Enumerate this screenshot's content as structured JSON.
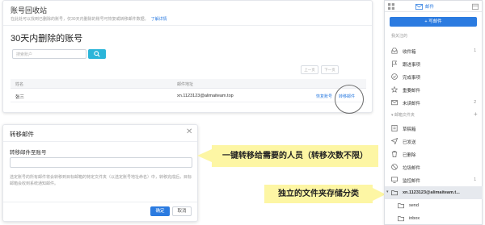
{
  "recycle": {
    "breadcrumb": "账号回收站",
    "subtitle": "在此处可以找到已删除的账号，仅30天内删除的账号可恢复或转移邮件数据。",
    "more_link": "了解详情",
    "heading": "30天内删除的账号",
    "search_placeholder": "搜索账户",
    "prev_page": "上一页",
    "next_page": "下一页",
    "columns": [
      "姓名",
      "邮件地址"
    ],
    "row": {
      "name": "张三",
      "email": "xn.1123123@alimaiteam.top",
      "action_restore": "恢复账号",
      "action_transfer": "转移邮件"
    }
  },
  "dialog": {
    "title": "转移邮件",
    "close_glyph": "✕",
    "field_label": "转移邮件至账号",
    "description": "选定账号的所有邮件将会转移到目标邮箱的特定文件夹（以选定账号地址命名）中，转移完成后，目标邮箱会收到系统通知邮件。",
    "confirm": "确定",
    "cancel": "取消"
  },
  "callouts": {
    "transfer_note": "一键转移给需要的人员（转移次数不限）",
    "folder_note": "独立的文件夹存储分类"
  },
  "sidebar": {
    "tab_mail": "邮件",
    "compose": "写邮件",
    "section_starred": "我关注的",
    "section_folders": "邮箱文件夹",
    "items": [
      {
        "label": "收件箱",
        "count": "1",
        "icon": "inbox-icon"
      },
      {
        "label": "跟进事项",
        "count": "",
        "icon": "flag-icon"
      },
      {
        "label": "完成事项",
        "count": "",
        "icon": "check-icon"
      },
      {
        "label": "重要邮件",
        "count": "",
        "icon": "star-icon"
      },
      {
        "label": "未读邮件",
        "count": "2",
        "icon": "unread-icon"
      }
    ],
    "folders": [
      {
        "label": "草稿箱",
        "count": "",
        "icon": "draft-icon"
      },
      {
        "label": "已发送",
        "count": "",
        "icon": "send-icon"
      },
      {
        "label": "已删除",
        "count": "",
        "icon": "trash-icon"
      },
      {
        "label": "垃圾邮件",
        "count": "",
        "icon": "spam-icon"
      },
      {
        "label": "监控邮件",
        "count": "1",
        "icon": "monitor-icon"
      }
    ],
    "transfer_folder": "xn.1123123@alimaiteam.t...",
    "subfolders": [
      "send",
      "inbox"
    ],
    "accent": "#2b7be0"
  }
}
